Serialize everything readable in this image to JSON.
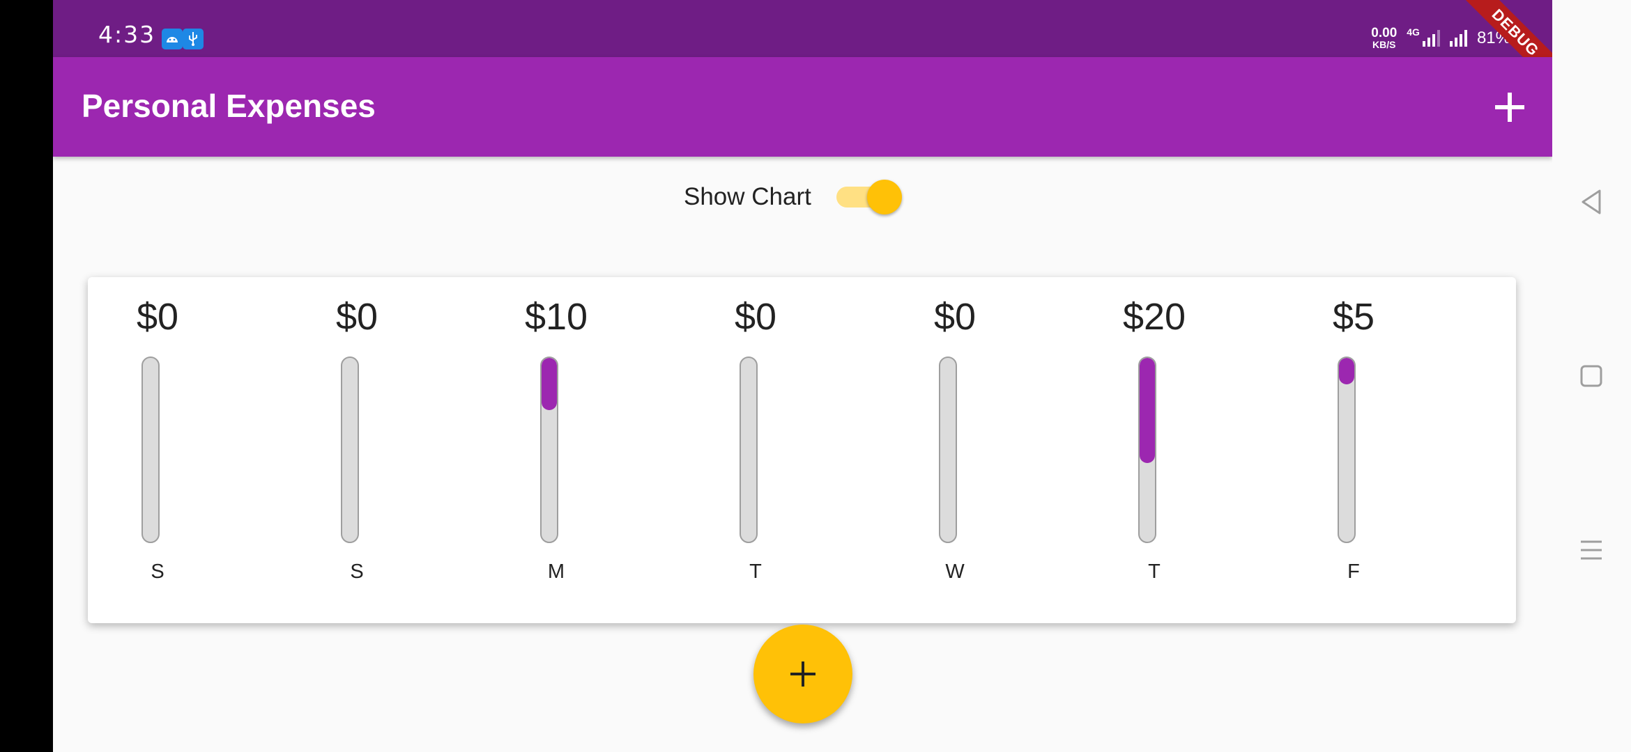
{
  "status_bar": {
    "time": "4:33",
    "net_speed_value": "0.00",
    "net_speed_unit": "KB/S",
    "network_type": "4G",
    "battery": "81%"
  },
  "debug_banner": "DEBUG",
  "app_bar": {
    "title": "Personal Expenses",
    "add_icon": "plus-icon"
  },
  "switch": {
    "label": "Show Chart",
    "on": true
  },
  "chart": {
    "days": [
      {
        "amount": "$0",
        "letter": "S",
        "pct": 0.0
      },
      {
        "amount": "$0",
        "letter": "S",
        "pct": 0.0
      },
      {
        "amount": "$10",
        "letter": "M",
        "pct": 0.2857
      },
      {
        "amount": "$0",
        "letter": "T",
        "pct": 0.0
      },
      {
        "amount": "$0",
        "letter": "W",
        "pct": 0.0
      },
      {
        "amount": "$20",
        "letter": "T",
        "pct": 0.5714
      },
      {
        "amount": "$5",
        "letter": "F",
        "pct": 0.1429
      }
    ]
  },
  "fab": {
    "icon": "plus-icon"
  },
  "colors": {
    "primary": "#9c27b0",
    "status_bar": "#6f1d85",
    "accent": "#ffc107",
    "background": "#fafafa"
  }
}
